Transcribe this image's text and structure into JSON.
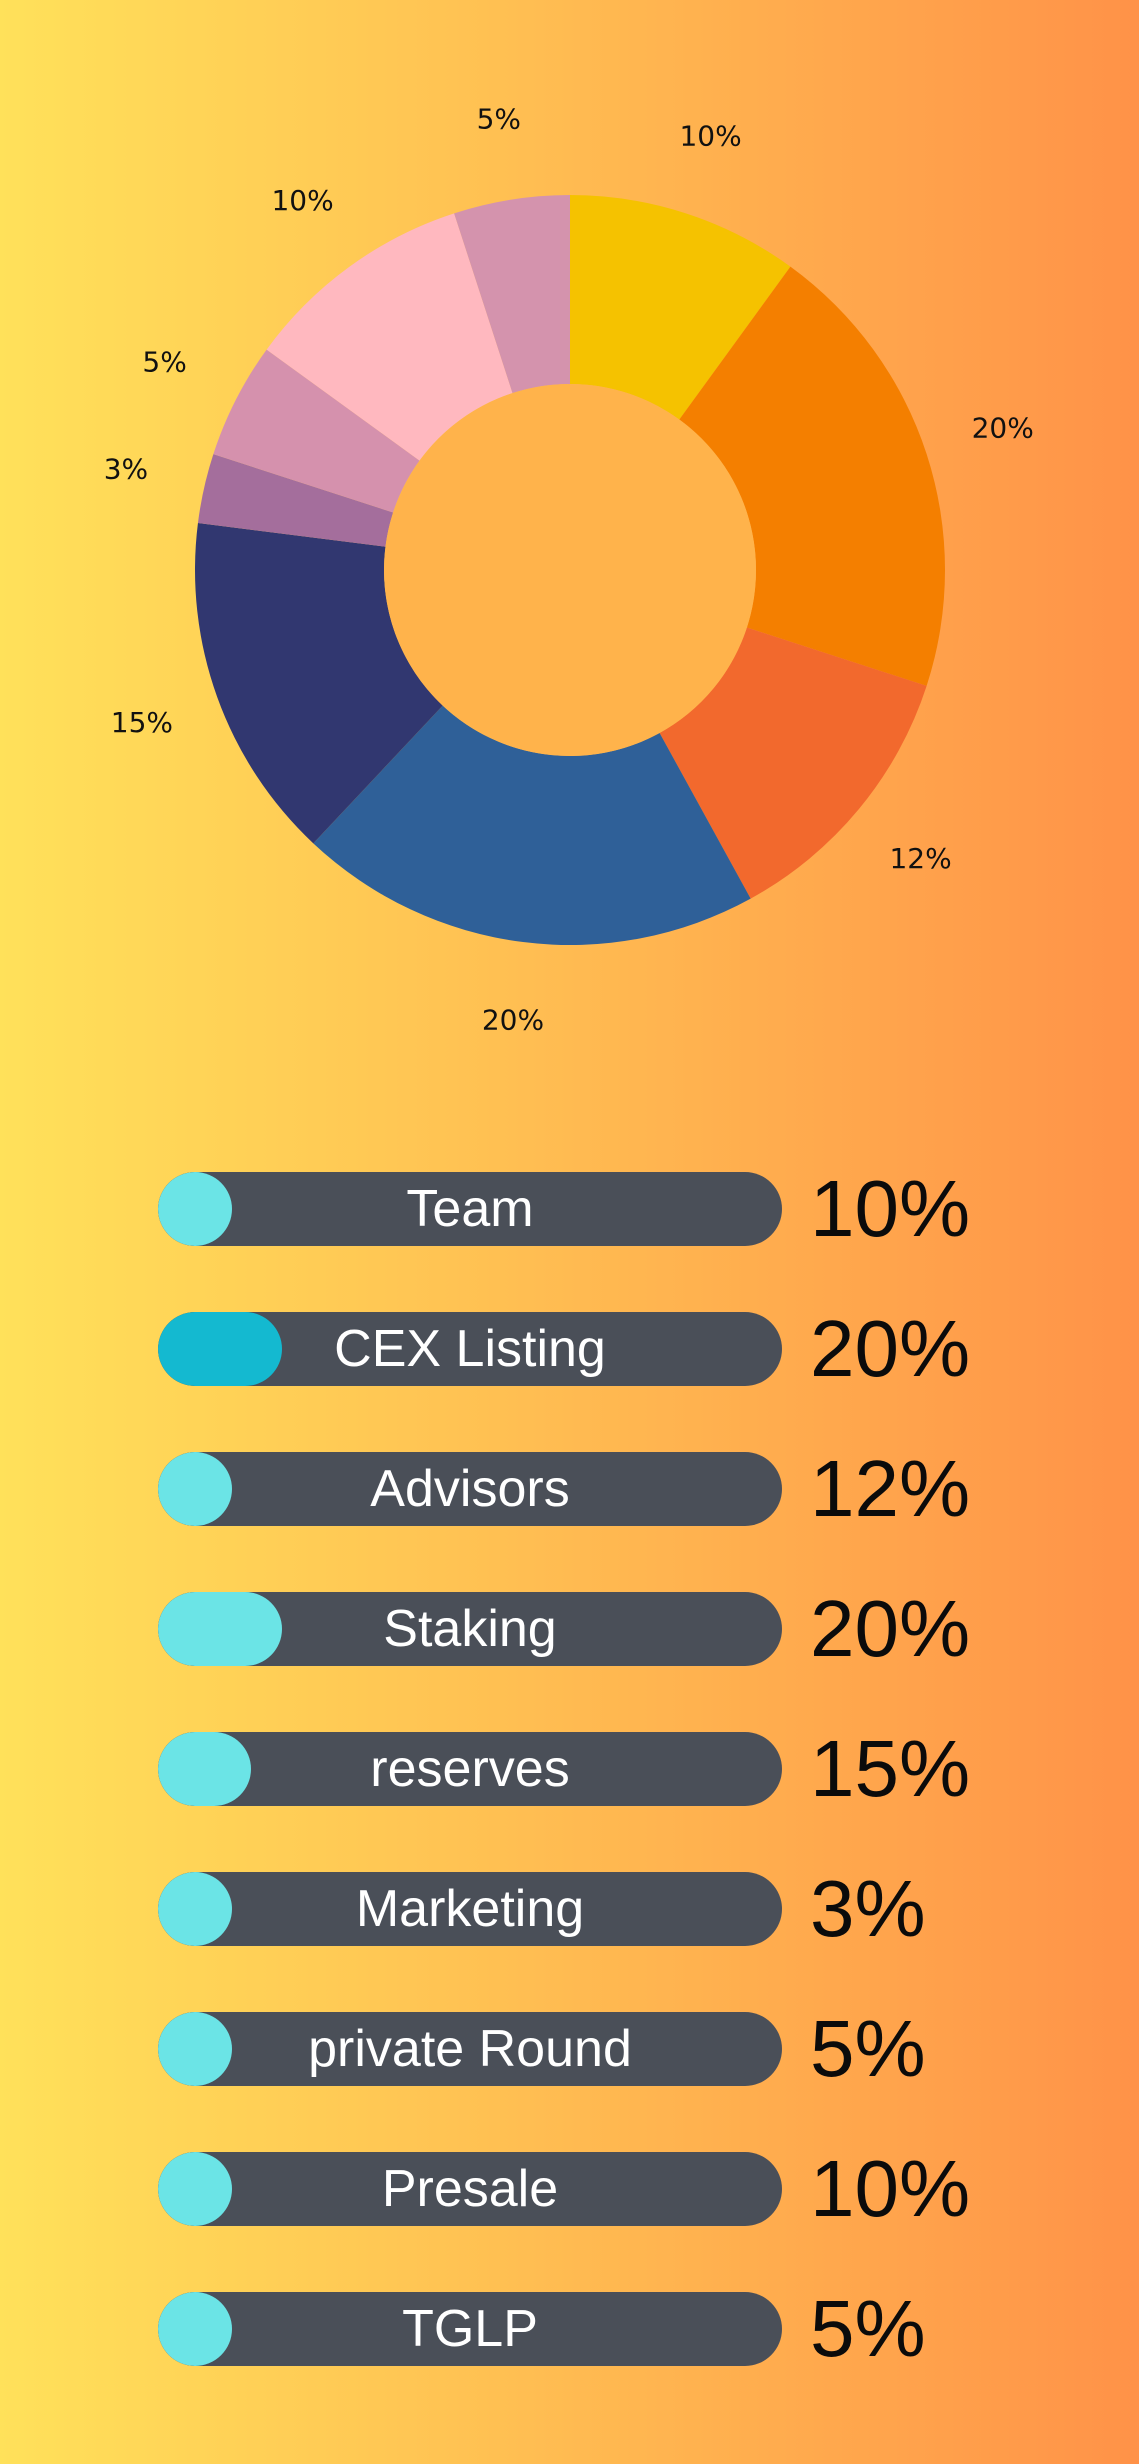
{
  "chart_data": {
    "type": "pie",
    "variant": "donut",
    "slices": [
      {
        "label": "10%",
        "value": 10,
        "color": "#f5c200"
      },
      {
        "label": "20%",
        "value": 20,
        "color": "#f47f00"
      },
      {
        "label": "12%",
        "value": 12,
        "color": "#f2692d"
      },
      {
        "label": "20%",
        "value": 20,
        "color": "#2f6098"
      },
      {
        "label": "15%",
        "value": 15,
        "color": "#313770"
      },
      {
        "label": "3%",
        "value": 3,
        "color": "#a46e9c"
      },
      {
        "label": "5%",
        "value": 5,
        "color": "#d591ad"
      },
      {
        "label": "10%",
        "value": 10,
        "color": "#ffb8bf"
      },
      {
        "label": "5%",
        "value": 5,
        "color": "#d493ad"
      }
    ],
    "hole_color": "#ffb34b"
  },
  "legend": [
    {
      "name": "Team",
      "percent": "10%",
      "value": 10,
      "fill_color": "#6be4e6"
    },
    {
      "name": "CEX Listing",
      "percent": "20%",
      "value": 20,
      "fill_color": "#14b9d0"
    },
    {
      "name": "Advisors",
      "percent": "12%",
      "value": 12,
      "fill_color": "#6be4e6"
    },
    {
      "name": "Staking",
      "percent": "20%",
      "value": 20,
      "fill_color": "#6be4e6"
    },
    {
      "name": "reserves",
      "percent": "15%",
      "value": 15,
      "fill_color": "#6be4e6"
    },
    {
      "name": "Marketing",
      "percent": "3%",
      "value": 3,
      "fill_color": "#6be4e6"
    },
    {
      "name": "private Round",
      "percent": "5%",
      "value": 5,
      "fill_color": "#6be4e6"
    },
    {
      "name": "Presale",
      "percent": "10%",
      "value": 10,
      "fill_color": "#6be4e6"
    },
    {
      "name": "TGLP",
      "percent": "5%",
      "value": 5,
      "fill_color": "#6be4e6"
    }
  ]
}
